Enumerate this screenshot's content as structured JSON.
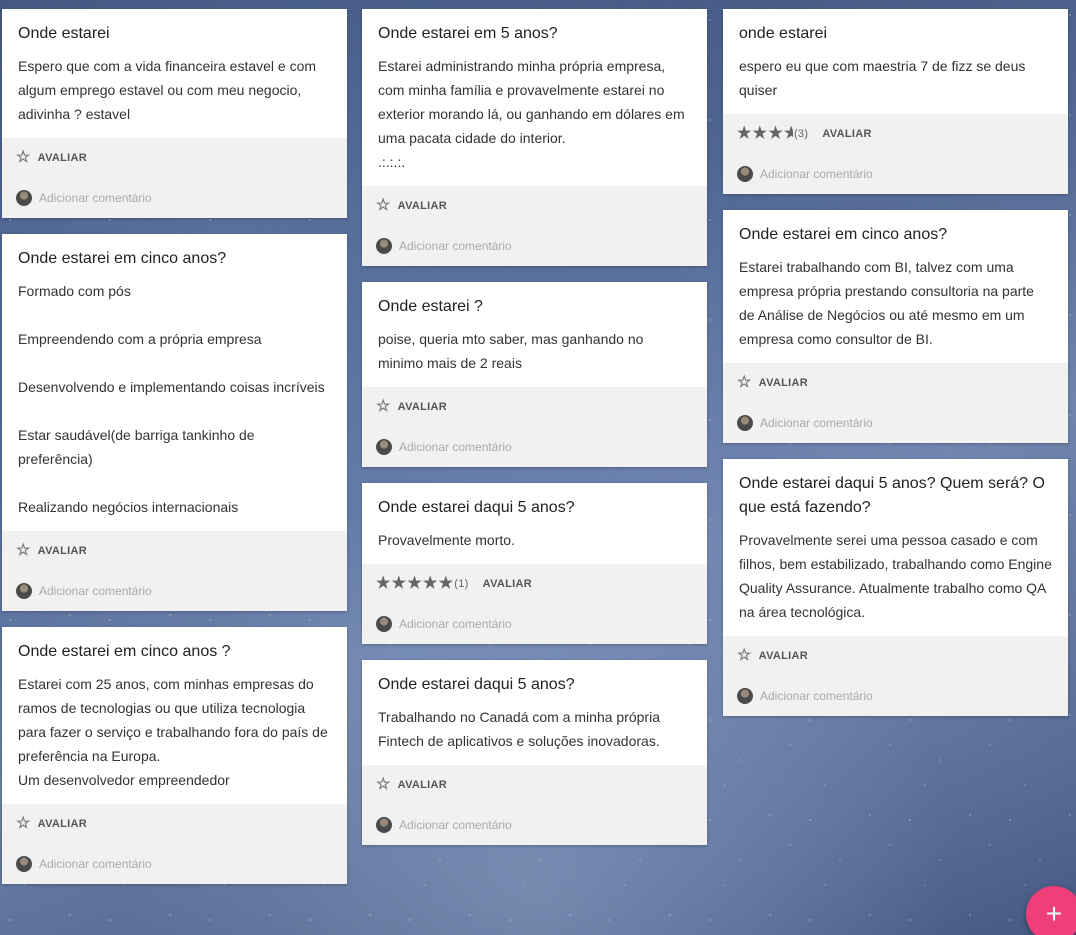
{
  "rate_label": "AVALIAR",
  "comment_placeholder": "Adicionar comentário",
  "fab_label": "+",
  "colors": {
    "fab": "#ef3f78",
    "card_footer": "#f1f1f1"
  },
  "columns": [
    [
      {
        "title": "Onde estarei",
        "text": "Espero que com a vida financeira estavel e com algum emprego estavel ou com meu negocio, adivinha ? estavel",
        "rating": null,
        "count": ""
      },
      {
        "title": "Onde estarei em cinco anos?",
        "text": "Formado com pós\n\nEmpreendendo com a própria empresa\n\nDesenvolvendo e implementando coisas incríveis\n\nEstar saudável(de barriga tankinho de preferência)\n\nRealizando negócios internacionais",
        "rating": null,
        "count": ""
      },
      {
        "title": "Onde estarei em cinco anos ?",
        "text": "Estarei com 25 anos, com minhas empresas do ramos de tecnologias ou que utiliza tecnologia para fazer o serviço e trabalhando fora do país de preferência na Europa.\nUm desenvolvedor empreendedor",
        "rating": null,
        "count": ""
      }
    ],
    [
      {
        "title": "Onde estarei em 5 anos?",
        "text": "Estarei administrando minha própria empresa, com minha família e provavelmente estarei no exterior morando lá, ou ganhando em dólares em uma pacata cidade do interior.\n.:.:.:.",
        "rating": null,
        "count": ""
      },
      {
        "title": "Onde estarei ?",
        "text": "poise, queria mto saber, mas ganhando no minimo mais de 2 reais",
        "rating": null,
        "count": ""
      },
      {
        "title": "Onde estarei daqui 5 anos?",
        "text": "Provavelmente morto.",
        "rating": 5,
        "count": "(1)"
      },
      {
        "title": "Onde estarei daqui 5 anos?",
        "text": "Trabalhando no Canadá com a minha própria Fintech de aplicativos e soluções inovadoras.",
        "rating": null,
        "count": ""
      }
    ],
    [
      {
        "title": "onde estarei",
        "text": "espero eu que com maestria 7 de fizz se deus quiser",
        "rating": 3.5,
        "count": "(3)"
      },
      {
        "title": "Onde estarei em cinco anos?",
        "text": "Estarei trabalhando com BI, talvez com uma empresa própria prestando consultoria na parte de Análise de Negócios ou até mesmo em um empresa como consultor de BI.",
        "rating": null,
        "count": ""
      },
      {
        "title": "Onde estarei daqui 5 anos? Quem será? O que está fazendo?",
        "text": "Provavelmente serei uma pessoa casado e com filhos, bem estabilizado, trabalhando como Engine Quality Assurance. Atualmente trabalho como QA na área tecnológica.",
        "rating": null,
        "count": ""
      }
    ]
  ]
}
